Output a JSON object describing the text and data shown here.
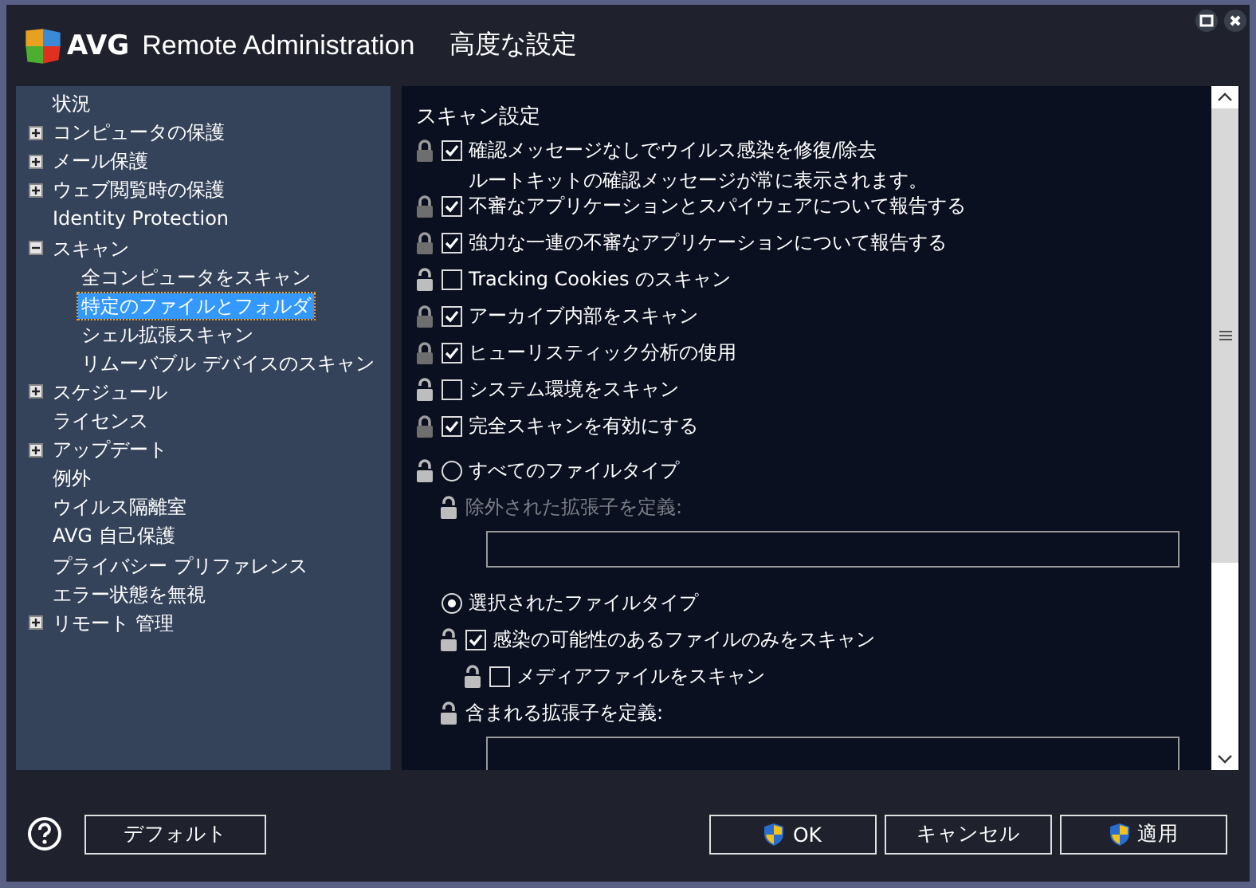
{
  "window": {
    "brand": "AVG",
    "product": "Remote Administration",
    "title": "高度な設定"
  },
  "tree": [
    {
      "label": "状況",
      "selected": false
    },
    {
      "label": "コンピュータの保護",
      "expanded": false,
      "selected": false
    },
    {
      "label": "メール保護",
      "expanded": false,
      "selected": false
    },
    {
      "label": "ウェブ閲覧時の保護",
      "expanded": false,
      "selected": false
    },
    {
      "label": "Identity Protection",
      "selected": false
    },
    {
      "label": "スキャン",
      "expanded": true,
      "selected": false,
      "children": [
        {
          "label": "全コンピュータをスキャン",
          "selected": false
        },
        {
          "label": "特定のファイルとフォルダ",
          "selected": true
        },
        {
          "label": "シェル拡張スキャン",
          "selected": false
        },
        {
          "label": "リムーバブル デバイスのスキャン",
          "selected": false
        }
      ]
    },
    {
      "label": "スケジュール",
      "expanded": false,
      "selected": false
    },
    {
      "label": "ライセンス",
      "selected": false
    },
    {
      "label": "アップデート",
      "expanded": false,
      "selected": false
    },
    {
      "label": "例外",
      "selected": false
    },
    {
      "label": "ウイルス隔離室",
      "selected": false
    },
    {
      "label": "AVG 自己保護",
      "selected": false
    },
    {
      "label": "プライバシー プリファレンス",
      "selected": false
    },
    {
      "label": "エラー状態を無視",
      "selected": false
    },
    {
      "label": "リモート 管理",
      "expanded": false,
      "selected": false
    }
  ],
  "panel": {
    "heading": "スキャン設定",
    "options": [
      {
        "kind": "checkbox",
        "locked": true,
        "checked": true,
        "label": "確認メッセージなしでウイルス感染を修復/除去",
        "note": "ルートキットの確認メッセージが常に表示されます。"
      },
      {
        "kind": "checkbox",
        "locked": true,
        "checked": true,
        "label": "不審なアプリケーションとスパイウェアについて報告する"
      },
      {
        "kind": "checkbox",
        "locked": true,
        "checked": true,
        "label": "強力な一連の不審なアプリケーションについて報告する"
      },
      {
        "kind": "checkbox",
        "locked": false,
        "checked": false,
        "label": "Tracking Cookies のスキャン"
      },
      {
        "kind": "checkbox",
        "locked": true,
        "checked": true,
        "label": "アーカイブ内部をスキャン"
      },
      {
        "kind": "checkbox",
        "locked": true,
        "checked": true,
        "label": "ヒューリスティック分析の使用"
      },
      {
        "kind": "checkbox",
        "locked": false,
        "checked": false,
        "label": "システム環境をスキャン"
      },
      {
        "kind": "checkbox",
        "locked": true,
        "checked": true,
        "label": "完全スキャンを有効にする"
      }
    ],
    "file_types": [
      {
        "kind": "radio",
        "locked": false,
        "selected": false,
        "label": "すべてのファイルタイプ",
        "children": [
          {
            "kind": "label",
            "locked": false,
            "disabled": true,
            "label": "除外された拡張子を定義:"
          },
          {
            "kind": "field"
          }
        ]
      },
      {
        "kind": "radio",
        "selected": true,
        "label": "選択されたファイルタイプ",
        "children": [
          {
            "kind": "checkbox",
            "locked": false,
            "checked": true,
            "label": "感染の可能性のあるファイルのみをスキャン",
            "children": [
              {
                "kind": "checkbox",
                "locked": false,
                "checked": false,
                "label": "メディアファイルをスキャン"
              }
            ]
          },
          {
            "kind": "label",
            "locked": false,
            "disabled": false,
            "label": "含まれる拡張子を定義:"
          },
          {
            "kind": "field"
          }
        ]
      }
    ]
  },
  "buttons": [
    {
      "label": "デフォルト",
      "kind": "plain"
    },
    {
      "label": "OK",
      "kind": "shield"
    },
    {
      "label": "キャンセル",
      "kind": "plain"
    },
    {
      "label": "適用",
      "kind": "shield"
    }
  ]
}
